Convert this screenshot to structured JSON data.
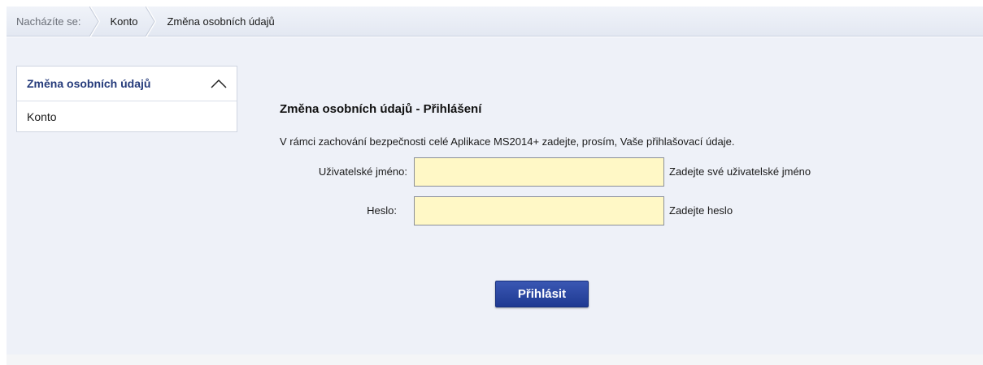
{
  "breadcrumb": {
    "lead": "Nacházíte se:",
    "items": [
      "Konto",
      "Změna osobních údajů"
    ]
  },
  "sidemenu": {
    "title": "Změna osobních údajů",
    "items": [
      "Konto"
    ]
  },
  "form": {
    "heading": "Změna osobních údajů - Přihlášení",
    "info": "V rámci zachování bezpečnosti celé Aplikace MS2014+ zadejte, prosím, Vaše přihlašovací údaje.",
    "username": {
      "label": "Uživatelské jméno:",
      "value": "",
      "hint": "Zadejte své uživatelské jméno"
    },
    "password": {
      "label": "Heslo:",
      "value": "",
      "hint": "Zadejte heslo"
    },
    "submit_label": "Přihlásit"
  },
  "colors": {
    "accent": "#243a7a",
    "button": "#2b47a3",
    "field_bg": "#fff8c6",
    "panel_bg": "#eef1f8"
  }
}
